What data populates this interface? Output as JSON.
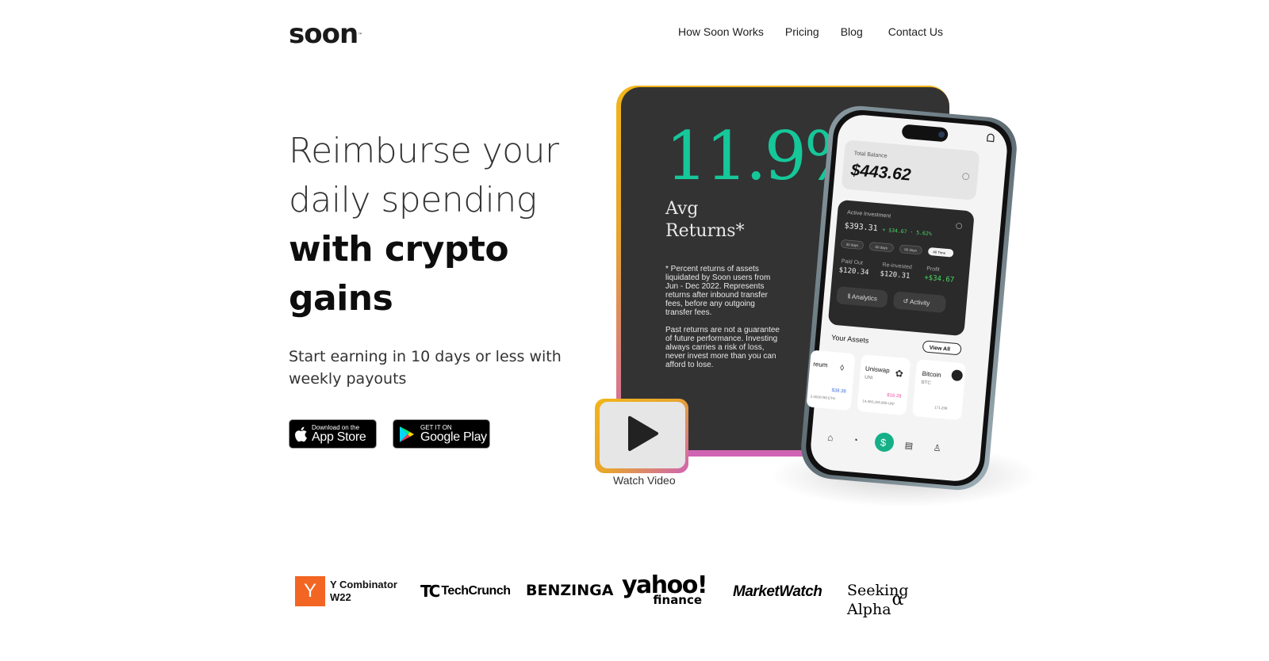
{
  "brand": {
    "logo_text": "soon",
    "logo_mark": "™"
  },
  "nav": {
    "items": [
      {
        "label": "How Soon Works"
      },
      {
        "label": "Pricing"
      },
      {
        "label": "Blog"
      },
      {
        "label": "Contact Us"
      }
    ]
  },
  "hero": {
    "title_line1": "Reimburse your",
    "title_line2": "daily spending",
    "title_line3": "with crypto",
    "title_line4": "gains",
    "subtitle": "Start earning in 10 days or less with weekly payouts"
  },
  "stores": {
    "appstore_small": "Download on the",
    "appstore_big": "App Store",
    "googleplay_small": "GET IT ON",
    "googleplay_big": "Google Play"
  },
  "card": {
    "percent": "11.9%*",
    "avg_returns": "Avg Returns*",
    "disclaimer1": "* Percent returns of assets liquidated by Soon users from Jun - Dec 2022. Represents returns after inbound transfer fees, before any outgoing transfer fees.",
    "disclaimer2": "Past returns are not a guarantee of future performance. Investing always carries a risk of loss, never invest more than you can afford to lose.",
    "accent_color": "#16c79a"
  },
  "video": {
    "label": "Watch Video"
  },
  "phone": {
    "total_balance_label": "Total Balance",
    "total_balance": "$443.62",
    "active_investment_label": "Active Investment",
    "active_investment": "$393.31",
    "active_change": "+ $34.67 · 5.62%",
    "ranges": [
      "30 days",
      "60 days",
      "90 days",
      "All Time"
    ],
    "paid_out_label": "Paid Out",
    "paid_out": "$120.34",
    "reinvested_label": "Re-invested",
    "reinvested": "$120.31",
    "profit_label": "Profit",
    "profit": "+$34.67",
    "analytics_btn": "Analytics",
    "activity_btn": "Activity",
    "your_assets": "Your Assets",
    "view_all": "View All",
    "assets": [
      {
        "name": "reum",
        "ticker": "",
        "value": "$38.38",
        "amount": "0.0000799 ETH"
      },
      {
        "name": "Uniswap",
        "ticker": "UNI",
        "value": "$16.28",
        "amount": "14,460,205.808 UNI"
      },
      {
        "name": "Bitcoin",
        "ticker": "BTC",
        "value": "",
        "amount": "171,298"
      }
    ]
  },
  "press": {
    "yc_letter": "Y",
    "yc_line1": "Y Combinator",
    "yc_line2": "W22",
    "techcrunch_mark": "TC",
    "techcrunch": "TechCrunch",
    "benzinga": "BENZINGA",
    "yahoo1": "yahoo!",
    "yahoo2": "finance",
    "marketwatch": "MarketWatch",
    "seeking": "Seeking Alpha",
    "seeking_symbol": "α"
  }
}
